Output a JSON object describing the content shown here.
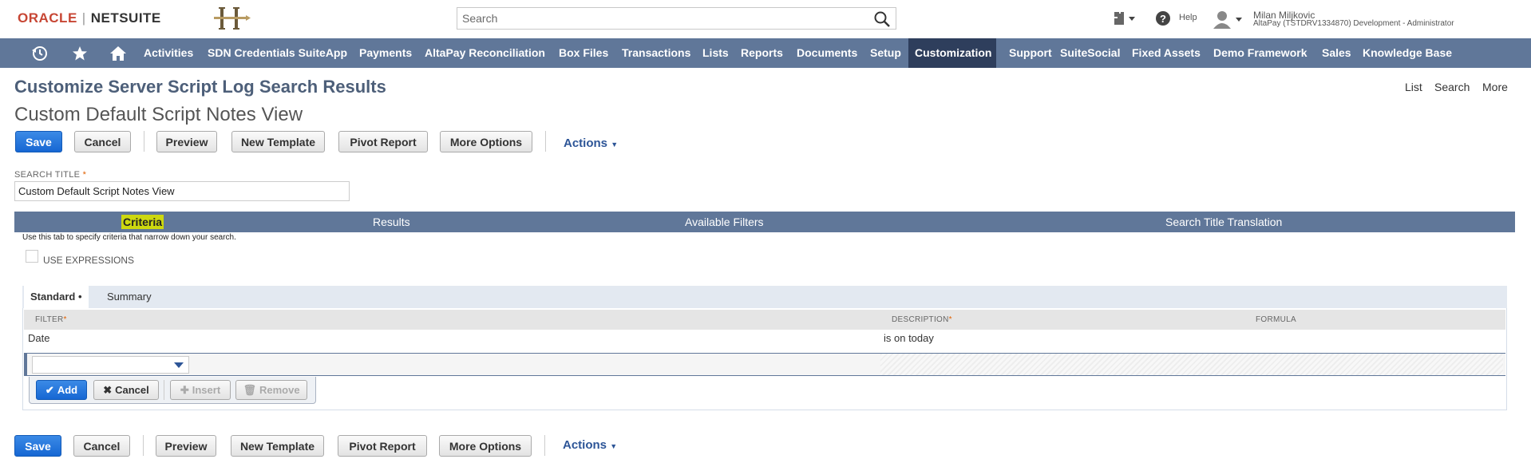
{
  "header": {
    "brand_oracle": "ORACLE",
    "brand_sep": "|",
    "brand_netsuite": "NETSUITE",
    "search_placeholder": "Search",
    "help_label": "Help",
    "user_name": "Milan Miljkovic",
    "user_account": "AltaPay (TSTDRV1334870) Development - Administrator"
  },
  "nav": {
    "items": [
      "Activities",
      "SDN Credentials SuiteApp",
      "Payments",
      "AltaPay Reconciliation",
      "Box Files",
      "Transactions",
      "Lists",
      "Reports",
      "Documents",
      "Setup",
      "Customization",
      "Support",
      "SuiteSocial",
      "Fixed Assets",
      "Demo Framework",
      "Sales",
      "Knowledge Base"
    ],
    "active": "Customization"
  },
  "page": {
    "title": "Customize Server Script Log Search Results",
    "subtitle": "Custom Default Script Notes View",
    "links": [
      "List",
      "Search",
      "More"
    ]
  },
  "toolbar": {
    "save": "Save",
    "cancel": "Cancel",
    "preview": "Preview",
    "new_template": "New Template",
    "pivot_report": "Pivot Report",
    "more_options": "More Options",
    "actions": "Actions"
  },
  "form": {
    "search_title_label": "SEARCH TITLE",
    "required_mark": "*",
    "search_title_value": "Custom Default Script Notes View"
  },
  "tabs": [
    "Criteria",
    "Results",
    "Available Filters",
    "Search Title Translation"
  ],
  "criteria": {
    "hint": "Use this tab to specify criteria that narrow down your search.",
    "use_expressions_label": "USE EXPRESSIONS",
    "subtabs": [
      "Standard •",
      "Summary"
    ],
    "columns": [
      "FILTER",
      "DESCRIPTION",
      "FORMULA"
    ],
    "rows": [
      {
        "filter": "Date",
        "description": "is on today",
        "formula": ""
      }
    ],
    "row_buttons": {
      "add": "Add",
      "cancel": "Cancel",
      "insert": "Insert",
      "remove": "Remove"
    }
  },
  "colors": {
    "nav_bg": "#607799",
    "nav_active": "#2e3e5c",
    "primary_button": "#1667d3",
    "tab_highlight": "#cdd80f",
    "brand_red": "#c74634"
  }
}
